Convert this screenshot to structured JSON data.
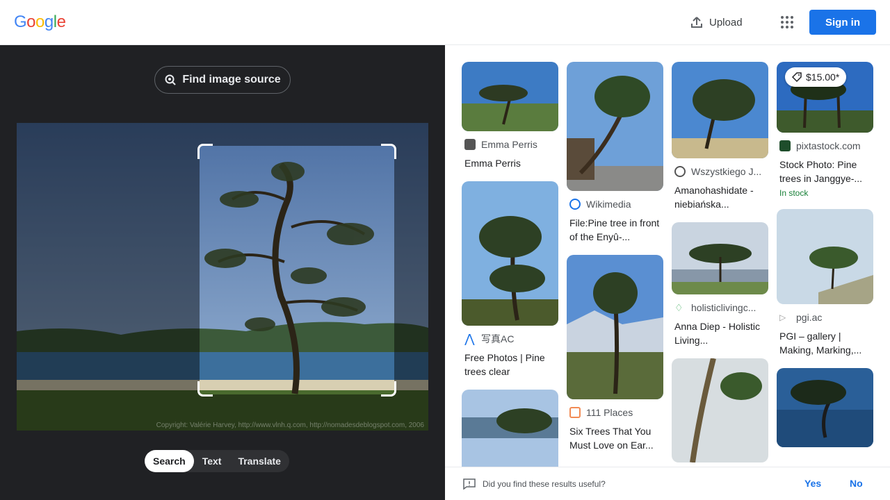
{
  "header": {
    "logo_letters": [
      {
        "ch": "G",
        "color": "#4285F4"
      },
      {
        "ch": "o",
        "color": "#EA4335"
      },
      {
        "ch": "o",
        "color": "#FBBC05"
      },
      {
        "ch": "g",
        "color": "#4285F4"
      },
      {
        "ch": "l",
        "color": "#34A853"
      },
      {
        "ch": "e",
        "color": "#EA4335"
      }
    ],
    "upload_label": "Upload",
    "apps_icon": "apps-grid-icon",
    "signin_label": "Sign in"
  },
  "lens": {
    "find_source_label": "Find image source",
    "copyright": "Copyright: Valérie Harvey, http://www.vlnh.q.com, http://nomadesdeblogspot.com, 2006",
    "modes": [
      {
        "label": "Search",
        "active": true
      },
      {
        "label": "Text",
        "active": false
      },
      {
        "label": "Translate",
        "active": false
      }
    ]
  },
  "results": {
    "columns": [
      [
        {
          "source": "Emma Perris",
          "title": "Emma Perris"
        },
        {
          "source": "写真AC",
          "title": "Free Photos | Pine trees clear"
        },
        {
          "source": "",
          "title": ""
        }
      ],
      [
        {
          "source": "Wikimedia",
          "title": "File:Pine tree in front of the Enyû-..."
        },
        {
          "source": "111 Places",
          "title": "Six Trees That You Must Love on Ear..."
        }
      ],
      [
        {
          "source": "Wszystkiego J...",
          "title": "Amanohashidate - niebiańska..."
        },
        {
          "source": "holisticlivingc...",
          "title": "Anna Diep - Holistic Living..."
        },
        {
          "source": "",
          "title": ""
        }
      ],
      [
        {
          "source": "pixtastock.com",
          "title": "Stock Photo: Pine trees in Janggye-...",
          "price": "$15.00*",
          "stock": "In stock"
        },
        {
          "source": "pgi.ac",
          "title": "PGI – gallery | Making, Marking,..."
        },
        {
          "source": "",
          "title": ""
        }
      ]
    ]
  },
  "feedback": {
    "question": "Did you find these results useful?",
    "yes": "Yes",
    "no": "No"
  }
}
